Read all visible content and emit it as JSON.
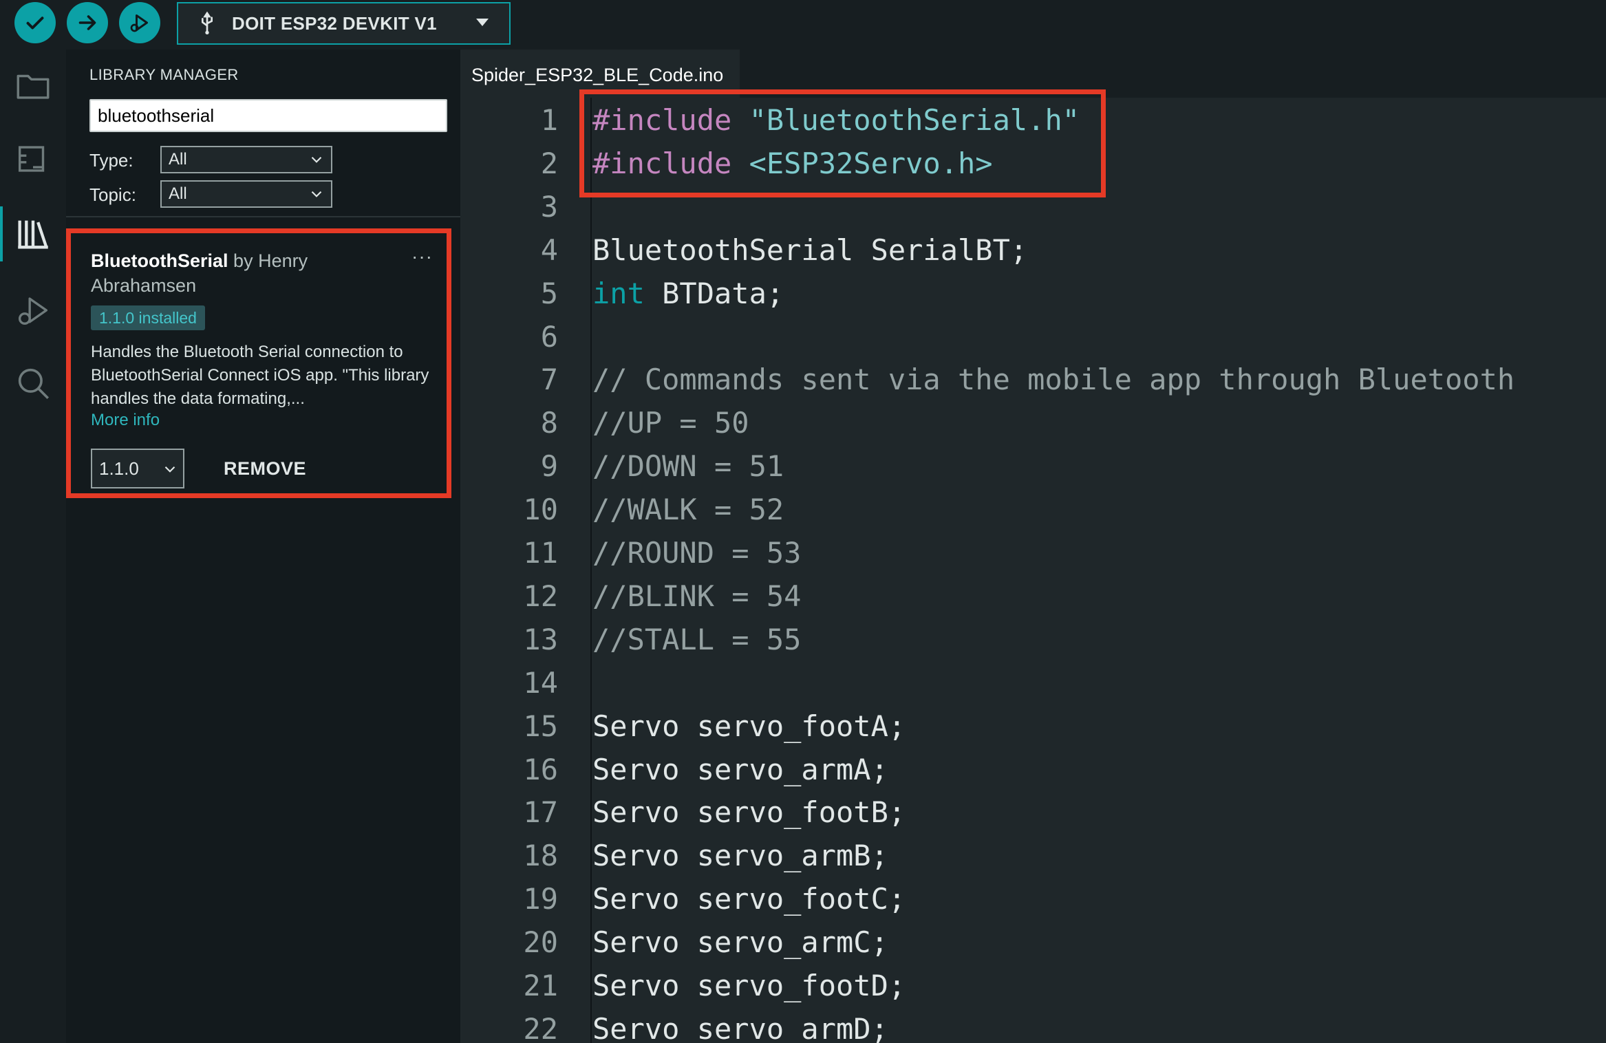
{
  "toolbar": {
    "board_name": "DOIT ESP32 DEVKIT V1",
    "buttons": [
      "verify-icon",
      "upload-icon",
      "debug-icon"
    ]
  },
  "activity_bar": [
    "folder-icon",
    "board-icon",
    "library-icon",
    "debug-icon",
    "search-icon"
  ],
  "library_manager": {
    "title": "LIBRARY MANAGER",
    "search_value": "bluetoothserial",
    "type_label": "Type:",
    "type_value": "All",
    "topic_label": "Topic:",
    "topic_value": "All",
    "library": {
      "name": "BluetoothSerial",
      "by": "by Henry",
      "author": "Abrahamsen",
      "more": "···",
      "badge": "1.1.0 installed",
      "description": "Handles the Bluetooth Serial connection to BluetoothSerial Connect iOS app. \"This library handles the data formating,...",
      "more_info": "More info",
      "version": "1.1.0",
      "remove": "REMOVE"
    }
  },
  "editor": {
    "tab": "Spider_ESP32_BLE_Code.ino",
    "lines": [
      {
        "n": "1",
        "text": "#include \"BluetoothSerial.h\""
      },
      {
        "n": "2",
        "text": "#include <ESP32Servo.h>"
      },
      {
        "n": "3",
        "text": ""
      },
      {
        "n": "4",
        "text": "BluetoothSerial SerialBT;"
      },
      {
        "n": "5",
        "text": "int BTData;"
      },
      {
        "n": "6",
        "text": ""
      },
      {
        "n": "7",
        "text": "// Commands sent via the mobile app through Bluetooth"
      },
      {
        "n": "8",
        "text": "//UP = 50"
      },
      {
        "n": "9",
        "text": "//DOWN = 51"
      },
      {
        "n": "10",
        "text": "//WALK = 52"
      },
      {
        "n": "11",
        "text": "//ROUND = 53"
      },
      {
        "n": "12",
        "text": "//BLINK = 54"
      },
      {
        "n": "13",
        "text": "//STALL = 55"
      },
      {
        "n": "14",
        "text": ""
      },
      {
        "n": "15",
        "text": "Servo servo_footA;"
      },
      {
        "n": "16",
        "text": "Servo servo_armA;"
      },
      {
        "n": "17",
        "text": "Servo servo_footB;"
      },
      {
        "n": "18",
        "text": "Servo servo_armB;"
      },
      {
        "n": "19",
        "text": "Servo servo_footC;"
      },
      {
        "n": "20",
        "text": "Servo servo_armC;"
      },
      {
        "n": "21",
        "text": "Servo servo_footD;"
      },
      {
        "n": "22",
        "text": "Servo servo_armD;"
      }
    ]
  },
  "colors": {
    "accent": "#0ca1a6",
    "highlight": "#e53a26",
    "preprocessor": "#c586c0",
    "string": "#7fcbcd",
    "comment": "#95a1a2"
  }
}
